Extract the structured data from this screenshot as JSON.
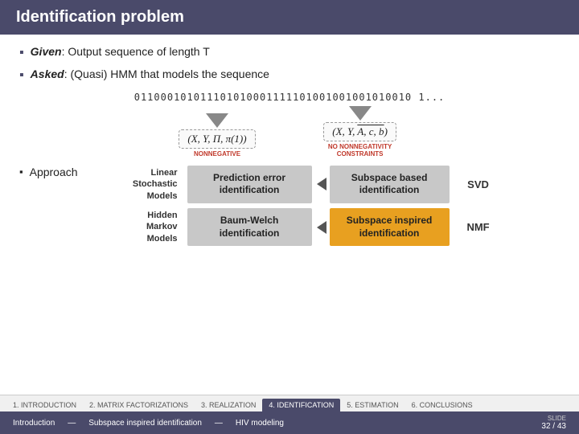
{
  "header": {
    "title": "Identification problem"
  },
  "bullets": [
    {
      "keyword": "Given",
      "text": ": Output sequence of length T"
    },
    {
      "keyword": "Asked",
      "text": ": (Quasi) HMM that models the sequence"
    }
  ],
  "sequence": "011000101011101010001111101001001001010010 1...",
  "formulas": [
    {
      "expr": "(X, Y, Π, π(1))",
      "label": "NONNEGATIVE"
    },
    {
      "expr": "(X, Y, A, c, b)",
      "label": "NO NONNEGATIVITY CONSTRAINTS"
    }
  ],
  "approach_label": "Approach",
  "methods": {
    "rows": [
      {
        "model": "Linear\nStochastic\nModels",
        "col1": "Prediction error\nidentification",
        "col2": "Subspace based\nidentification",
        "col2_type": "gray",
        "side_label": "SVD"
      },
      {
        "model": "Hidden\nMarkov\nModels",
        "col1": "Baum-Welch\nidentification",
        "col2": "Subspace inspired\nidentification",
        "col2_type": "orange",
        "side_label": "NMF"
      }
    ]
  },
  "nav": {
    "tabs": [
      {
        "label": "1. INTRODUCTION",
        "active": false
      },
      {
        "label": "2. MATRIX FACTORIZATIONS",
        "active": false
      },
      {
        "label": "3. REALIZATION",
        "active": false
      },
      {
        "label": "4. IDENTIFICATION",
        "active": true
      },
      {
        "label": "5. ESTIMATION",
        "active": false
      },
      {
        "label": "6. CONCLUSIONS",
        "active": false
      }
    ],
    "footer_left": "Introduction",
    "footer_sep1": "—",
    "footer_mid": "Subspace inspired identification",
    "footer_sep2": "—",
    "footer_right": "HIV modeling",
    "slide_label": "SLIDE",
    "slide_current": "32",
    "slide_total": "43"
  }
}
